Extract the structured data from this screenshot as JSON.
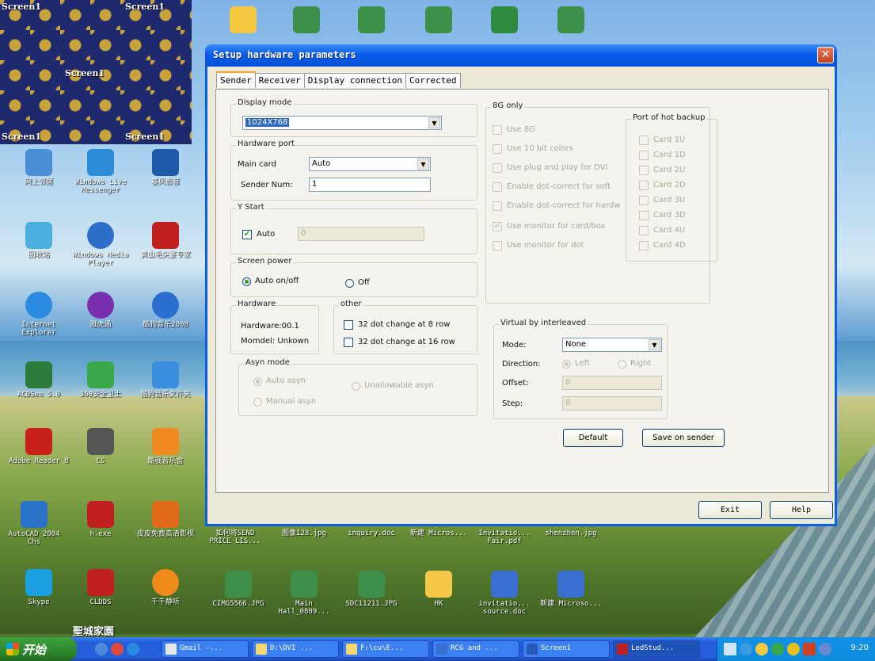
{
  "desktop": {
    "screen1_labels": [
      "Screen1",
      "Screen1",
      "Screen1",
      "Screen1",
      "Screen1"
    ],
    "icons": [
      {
        "label": "网上邻居",
        "color": "#4a90d9"
      },
      {
        "label": "Windows Live Messenger",
        "color": "#2e8bd8"
      },
      {
        "label": "暴风影音",
        "color": "#1d5aa8"
      },
      {
        "label": "回收站",
        "color": "#4bb0e0"
      },
      {
        "label": "Windows Media Player",
        "color": "#2d6ec9"
      },
      {
        "label": "黄山毛尖宴专家",
        "color": "#c02020"
      },
      {
        "label": "Internet Explorer",
        "color": "#2a8ae0"
      },
      {
        "label": "雅虎通",
        "color": "#7a2fb0"
      },
      {
        "label": "酷狗音乐2008",
        "color": "#2a6fd0"
      },
      {
        "label": "ACDSee 5.0",
        "color": "#2c7a3a"
      },
      {
        "label": "360安全卫士",
        "color": "#3aa84a"
      },
      {
        "label": "酷狗音乐文件夹",
        "color": "#3a8ee0"
      },
      {
        "label": "Adobe Reader 8",
        "color": "#c8201a"
      },
      {
        "label": "CS",
        "color": "#555555"
      },
      {
        "label": "酷我音乐盒",
        "color": "#f08a20"
      },
      {
        "label": "AutoCAD 2004 Chs",
        "color": "#2a72c8"
      },
      {
        "label": "h.exe",
        "color": "#c02020"
      },
      {
        "label": "皮皮免费高清影视",
        "color": "#e06a1a"
      },
      {
        "label": "Skype",
        "color": "#1aa0e0"
      },
      {
        "label": "CLDDS",
        "color": "#c02020"
      },
      {
        "label": "千千静听",
        "color": "#f08a1a"
      },
      {
        "label": "如何将SEND PRICE LIS...",
        "color": "#f0f0f0"
      },
      {
        "label": "图像128.jpg",
        "color": "#f0f0f0"
      },
      {
        "label": "inquiry.doc",
        "color": "#f0f0f0"
      },
      {
        "label": "新建 Micros...",
        "color": "#f0f0f0"
      },
      {
        "label": "Invitatio... Fair.pdf",
        "color": "#f0f0f0"
      },
      {
        "label": "shenzhen.jpg",
        "color": "#f0f0f0"
      },
      {
        "label": "CIMG5566.JPG",
        "color": "#f0f0f0"
      },
      {
        "label": "Main Hall_0809...",
        "color": "#f0f0f0"
      },
      {
        "label": "SDC11211.JPG",
        "color": "#f0f0f0"
      },
      {
        "label": "HK",
        "color": "#f5c84a"
      },
      {
        "label": "invitatio... source.doc",
        "color": "#3a6ed0"
      },
      {
        "label": "新建 Microso...",
        "color": "#3a6ed0"
      }
    ],
    "watermark": "聖城家園"
  },
  "dialog": {
    "title": "Setup hardware parameters",
    "close_glyph": "✕",
    "tabs": [
      "Sender",
      "Receiver",
      "Display connection",
      "Corrected"
    ],
    "display_mode": {
      "title": "Display mode",
      "value": "1024X768"
    },
    "hardware_port": {
      "title": "Hardware port",
      "main_card_label": "Main card",
      "main_card_value": "Auto",
      "sender_num_label": "Sender Num:",
      "sender_num_value": "1"
    },
    "y_start": {
      "title": "Y Start",
      "auto_label": "Auto",
      "auto_checked": true,
      "value": "0"
    },
    "screen_power": {
      "title": "Screen power",
      "auto_label": "Auto on/off",
      "off_label": "Off"
    },
    "hardware": {
      "title": "Hardware",
      "hardware_line": "Hardware:00.1",
      "momdel_line": "Momdel: Unkown"
    },
    "other": {
      "title": "other",
      "opt1": "32 dot change at 8 row",
      "opt2": "32 dot change at 16 row"
    },
    "asyn_mode": {
      "title": "Asyn mode",
      "auto": "Auto asyn",
      "unallowable": "Unallowable asyn",
      "manual": "Manual asyn"
    },
    "eight_g": {
      "title": "8G only",
      "options": [
        "Use 8G",
        "Use 10 bit colors",
        "Use plug and play for DVI",
        "Enable dot-correct for soft",
        "Enable dot-correct for hardw",
        "Use monitor for card/box",
        "Use monitor for dot"
      ],
      "checked_index": 5
    },
    "hot_backup": {
      "title": "Port of hot backup",
      "cards": [
        "Card 1U",
        "Card 1D",
        "Card 2U",
        "Card 2D",
        "Card 3U",
        "Card 3D",
        "Card 4U",
        "Card 4D"
      ]
    },
    "virtual": {
      "title": "Virtual by interleaved",
      "mode_label": "Mode:",
      "mode_value": "None",
      "direction_label": "Direction:",
      "left_label": "Left",
      "right_label": "Right",
      "offset_label": "Offset:",
      "offset_value": "0",
      "step_label": "Step:",
      "step_value": "0"
    },
    "buttons": {
      "default": "Default",
      "save": "Save on sender",
      "exit": "Exit",
      "help": "Help"
    }
  },
  "taskbar": {
    "start": "开始",
    "tasks": [
      "Gmail -...",
      "D:\\DVI ...",
      "F:\\cu\\E...",
      "RCG and ...",
      "Screen1",
      "LedStud..."
    ],
    "clock": "9:20"
  }
}
